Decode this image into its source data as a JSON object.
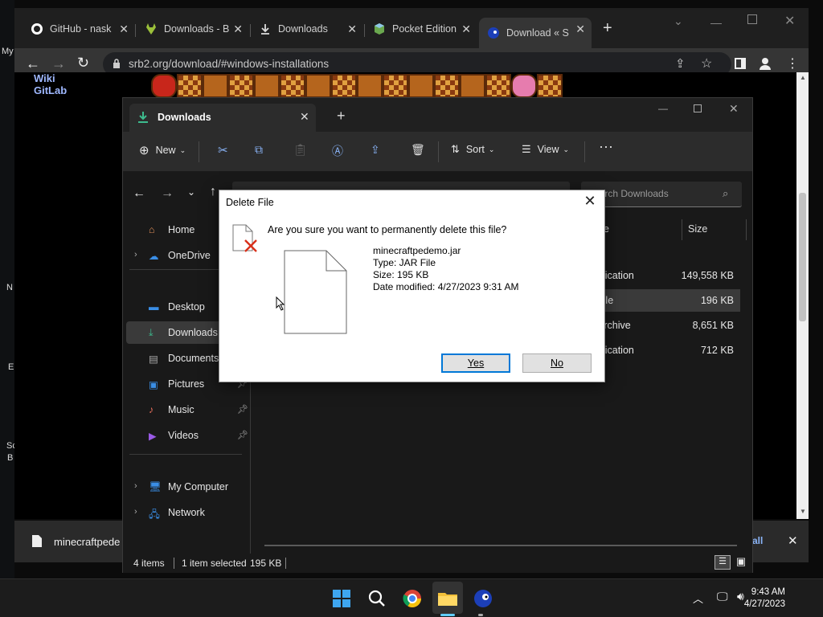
{
  "desktop": {
    "labels": [
      "My",
      "N",
      "E",
      "Sc",
      "B"
    ]
  },
  "browser": {
    "tabs": [
      {
        "title": "GitHub - nask",
        "icon": "github-icon"
      },
      {
        "title": "Downloads - B",
        "icon": "gitlab-icon"
      },
      {
        "title": "Downloads",
        "icon": "download-icon"
      },
      {
        "title": "Pocket Edition",
        "icon": "cube-icon"
      },
      {
        "title": "Download « S",
        "icon": "sonic-icon"
      }
    ],
    "url": "srb2.org/download/#windows-installations",
    "page_links": [
      "Wiki",
      "GitLab"
    ],
    "download_bar": {
      "file": "minecraftpede",
      "show_all": "all"
    }
  },
  "explorer": {
    "tab_title": "Downloads",
    "toolbar": {
      "new": "New",
      "sort": "Sort",
      "view": "View"
    },
    "search_placeholder": "Search Downloads",
    "sidebar": [
      {
        "label": "Home",
        "icon": "home-icon"
      },
      {
        "label": "OneDrive",
        "icon": "cloud-icon"
      },
      {
        "label": "Desktop",
        "icon": "desktop-icon"
      },
      {
        "label": "Downloads",
        "icon": "download-icon"
      },
      {
        "label": "Documents",
        "icon": "document-icon"
      },
      {
        "label": "Pictures",
        "icon": "pictures-icon"
      },
      {
        "label": "Music",
        "icon": "music-icon"
      },
      {
        "label": "Videos",
        "icon": "video-icon"
      },
      {
        "label": "My Computer",
        "icon": "computer-icon"
      },
      {
        "label": "Network",
        "icon": "network-icon"
      }
    ],
    "columns": {
      "type": "e",
      "size": "Size"
    },
    "rows": [
      {
        "type": "plication",
        "size": "149,558 KB"
      },
      {
        "type": "File",
        "size": "196 KB"
      },
      {
        "type": "Archive",
        "size": "8,651 KB"
      },
      {
        "type": "plication",
        "size": "712 KB"
      }
    ],
    "status": {
      "items": "4 items",
      "selected": "1 item selected",
      "size": "195 KB"
    }
  },
  "dialog": {
    "title": "Delete File",
    "question": "Are you sure you want to permanently delete this file?",
    "file_name": "minecraftpedemo.jar",
    "file_type": "Type: JAR File",
    "file_size": "Size: 195 KB",
    "file_date": "Date modified: 4/27/2023 9:31 AM",
    "yes": "Yes",
    "no": "No"
  },
  "taskbar": {
    "time": "9:43 AM",
    "date": "4/27/2023"
  }
}
